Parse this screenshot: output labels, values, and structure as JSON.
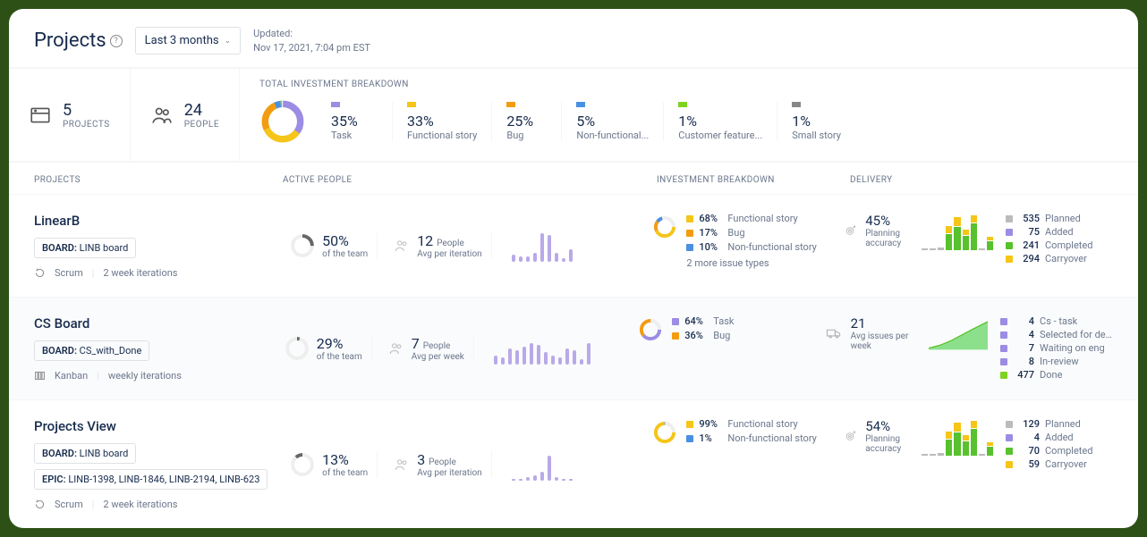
{
  "header": {
    "title": "Projects",
    "range": "Last 3 months",
    "updated_label": "Updated:",
    "updated_value": "Nov 17, 2021, 7:04 pm EST"
  },
  "summary": {
    "projects": {
      "count": "5",
      "label": "PROJECTS"
    },
    "people": {
      "count": "24",
      "label": "PEOPLE"
    },
    "invest_title": "TOTAL INVESTMENT BREAKDOWN",
    "invest_items": [
      {
        "pct": "35%",
        "label": "Task",
        "color": "#9c8ce4"
      },
      {
        "pct": "33%",
        "label": "Functional story",
        "color": "#f5c518"
      },
      {
        "pct": "25%",
        "label": "Bug",
        "color": "#f39c12"
      },
      {
        "pct": "5%",
        "label": "Non-functional...",
        "color": "#4a90e2"
      },
      {
        "pct": "1%",
        "label": "Customer feature...",
        "color": "#7ed321"
      },
      {
        "pct": "1%",
        "label": "Small story",
        "color": "#888888"
      }
    ]
  },
  "cols": {
    "projects": "PROJECTS",
    "active": "ACTIVE PEOPLE",
    "invest": "INVESTMENT BREAKDOWN",
    "delivery": "DELIVERY"
  },
  "rows": [
    {
      "name": "LinearB",
      "board_label": "BOARD:",
      "board": "LINB board",
      "method": "Scrum",
      "iter": "2 week iterations",
      "team_pct": "50%",
      "team_sub": "of the team",
      "people": "12",
      "people_unit": "People",
      "people_sub": "Avg per iteration",
      "spark": [
        8,
        6,
        6,
        10,
        32,
        30,
        10,
        4,
        14
      ],
      "inv_items": [
        {
          "pct": "68%",
          "cat": "Functional story",
          "color": "#f5c518"
        },
        {
          "pct": "17%",
          "cat": "Bug",
          "color": "#f39c12"
        },
        {
          "pct": "10%",
          "cat": "Non-functional story",
          "color": "#4a90e2"
        }
      ],
      "inv_more": "2 more issue types",
      "deliv_val": "45%",
      "deliv_sub": "Planning accuracy",
      "deliv_icon": "target",
      "deliv_stats": [
        {
          "n": "535",
          "l": "Planned",
          "c": "#bbb"
        },
        {
          "n": "75",
          "l": "Added",
          "c": "#9c8ce4"
        },
        {
          "n": "241",
          "l": "Completed",
          "c": "#57c22d"
        },
        {
          "n": "294",
          "l": "Carryover",
          "c": "#f5c518"
        }
      ],
      "chart_type": "stacks"
    },
    {
      "name": "CS Board",
      "board_label": "BOARD:",
      "board": "CS_with_Done",
      "method": "Kanban",
      "iter": "weekly iterations",
      "team_pct": "29%",
      "team_sub": "of the team",
      "people": "7",
      "people_unit": "People",
      "people_sub": "Avg per week",
      "spark": [
        10,
        8,
        18,
        16,
        20,
        24,
        22,
        14,
        10,
        8,
        18,
        16,
        6,
        24
      ],
      "inv_items": [
        {
          "pct": "64%",
          "cat": "Task",
          "color": "#9c8ce4"
        },
        {
          "pct": "36%",
          "cat": "Bug",
          "color": "#f39c12"
        }
      ],
      "deliv_val": "21",
      "deliv_sub": "Avg issues per week",
      "deliv_icon": "truck",
      "deliv_stats": [
        {
          "n": "4",
          "l": "Cs - task",
          "c": "#9c8ce4"
        },
        {
          "n": "4",
          "l": "Selected for develop...",
          "c": "#9c8ce4"
        },
        {
          "n": "7",
          "l": "Waiting on eng",
          "c": "#9c8ce4"
        },
        {
          "n": "8",
          "l": "In-review",
          "c": "#9c8ce4"
        },
        {
          "n": "477",
          "l": "Done",
          "c": "#7ed321"
        }
      ],
      "chart_type": "area"
    },
    {
      "name": "Projects View",
      "board_label": "BOARD:",
      "board": "LINB board",
      "epic_label": "EPIC:",
      "epic": "LINB-1398, LINB-1846, LINB-2194, LINB-623",
      "method": "Scrum",
      "iter": "2 week iterations",
      "team_pct": "13%",
      "team_sub": "of the team",
      "people": "3",
      "people_unit": "People",
      "people_sub": "Avg per iteration",
      "spark": [
        2,
        2,
        4,
        6,
        10,
        28,
        4,
        2,
        2
      ],
      "inv_items": [
        {
          "pct": "99%",
          "cat": "Functional story",
          "color": "#f5c518"
        },
        {
          "pct": "1%",
          "cat": "Non-functional story",
          "color": "#4a90e2"
        }
      ],
      "deliv_val": "54%",
      "deliv_sub": "Planning accuracy",
      "deliv_icon": "target",
      "deliv_stats": [
        {
          "n": "129",
          "l": "Planned",
          "c": "#bbb"
        },
        {
          "n": "4",
          "l": "Added",
          "c": "#9c8ce4"
        },
        {
          "n": "70",
          "l": "Completed",
          "c": "#57c22d"
        },
        {
          "n": "59",
          "l": "Carryover",
          "c": "#f5c518"
        }
      ],
      "chart_type": "stacks"
    }
  ]
}
